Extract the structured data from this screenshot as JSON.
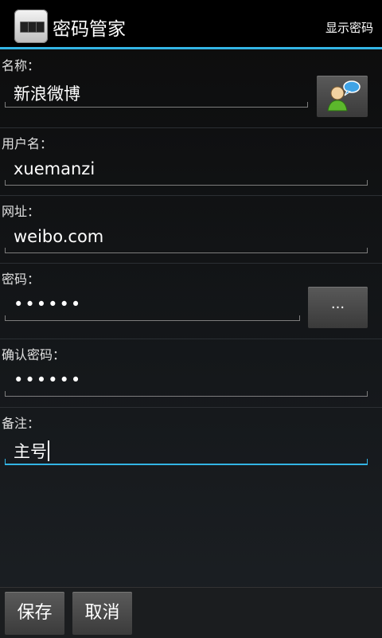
{
  "actionbar": {
    "title": "密码管家",
    "show_password": "显示密码"
  },
  "form": {
    "name": {
      "label": "名称：",
      "value": "新浪微博"
    },
    "username": {
      "label": "用户名：",
      "value": "xuemanzi"
    },
    "url": {
      "label": "网址：",
      "value": "weibo.com"
    },
    "password": {
      "label": "密码：",
      "value": "••••••",
      "generate_label": "..."
    },
    "confirm": {
      "label": "确认密码：",
      "value": "••••••"
    },
    "note": {
      "label": "备注：",
      "value": "主号"
    }
  },
  "buttons": {
    "save": "保存",
    "cancel": "取消"
  },
  "colors": {
    "accent": "#33b5e5",
    "background": "#15181b"
  }
}
